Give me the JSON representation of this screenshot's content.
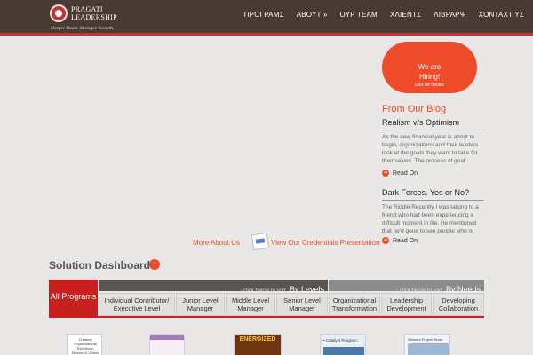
{
  "brand": {
    "name": "PRAGATI LEADERSHIP",
    "tagline": "Deeper Roots. Stronger Growth."
  },
  "nav": {
    "items": [
      "ΠΡΟΓΡΑΜΣ",
      "ΑΒΟΥΤ »",
      "ΟΥΡ ΤΕΑΜ",
      "ΧΛΙΕΝΤΣ",
      "ΛΙΒΡΑΡΨ",
      "ΧΟΝΤΑΧΤ ΥΣ"
    ]
  },
  "hiring": {
    "line1": "We are",
    "line2": "Hiring!",
    "line3": "click for details"
  },
  "blog": {
    "heading": "From Our Blog",
    "posts": [
      {
        "title": "Realism v/s Optimism",
        "excerpt": "As the new financial year is about to begin, organizations and their leaders look at the goals they want to take for themselves.  The process of goal",
        "read_on": "Read On"
      },
      {
        "title": "Dark Forces. Yes or No?",
        "excerpt": "The Riddle Recently I was talking to a friend who had been experiencing a difficult moment in life. He mentioned that he'd gone to see people who re",
        "read_on": "Read On"
      }
    ]
  },
  "links": {
    "more_about": "More About Us",
    "credentials": "View Our Credentials Presentation"
  },
  "dashboard": {
    "title": "Solution Dashboard",
    "all_programs": "All Programs",
    "levels_hint_small": "↓ click below to sort",
    "levels_hint_big": "By Levels",
    "needs_hint_small": "↓ click below to sort",
    "needs_hint_big": "By Needs",
    "level_filters": [
      "Individual Contributor/ Executive Level",
      "Junior Level Manager",
      "Middle Level Manager",
      "Senior Level Manager"
    ],
    "need_filters": [
      "Organizational Transformation",
      "Leadership Development",
      "Developing Collaboration"
    ]
  },
  "thumbs": {
    "t1": "Creating Organizational DNA Vision, Mission & Values",
    "t3": "ENERGIZED",
    "t4": "• Catalyst Program:",
    "t5": "Winners Project Team"
  },
  "colors": {
    "header": "#4a3a34",
    "accent": "#ee4b2b",
    "red": "#c8201f"
  }
}
